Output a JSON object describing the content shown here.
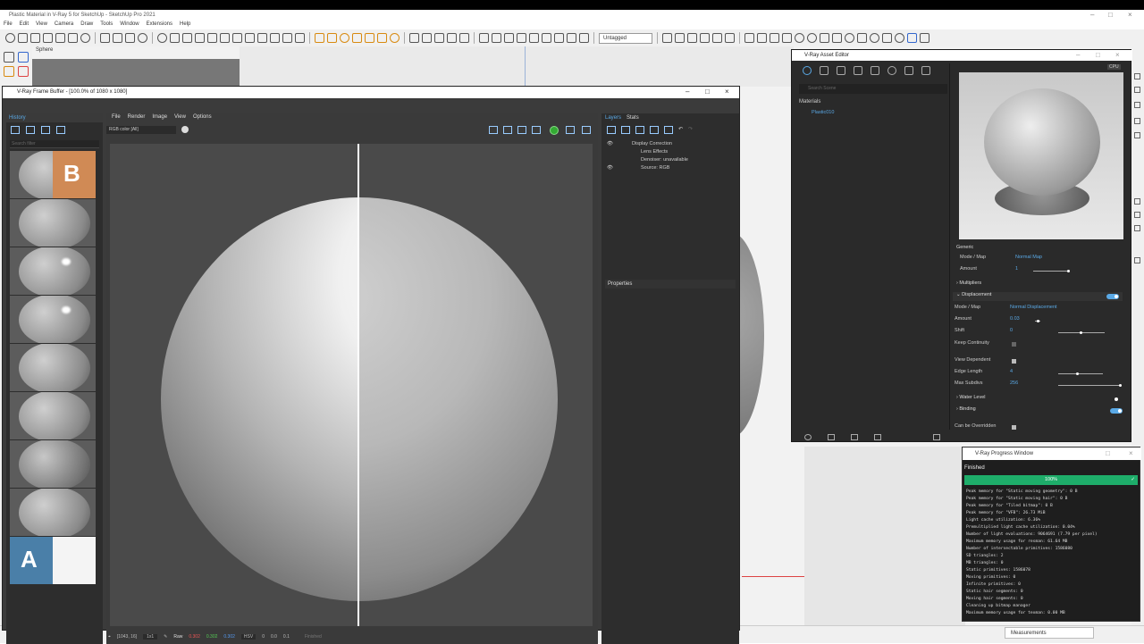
{
  "sketchup": {
    "title": "Plastic Material in V-Ray 5 for SketchUp - SketchUp Pro 2021",
    "menu": [
      "File",
      "Edit",
      "View",
      "Camera",
      "Draw",
      "Tools",
      "Window",
      "Extensions",
      "Help"
    ],
    "tag_select": "Untagged",
    "viewport_label": "Sphere",
    "measurements_label": "Measurements"
  },
  "vfb": {
    "title": "V-Ray Frame Buffer - [100.0% of 1080 x 1080]",
    "history_tab": "History",
    "search_placeholder": "Search filter",
    "badges": [
      "B",
      "A"
    ],
    "menu": [
      "File",
      "Render",
      "Image",
      "View",
      "Options"
    ],
    "channel_select": "RGB color [All]",
    "layer_tabs": [
      "Layers",
      "Stats"
    ],
    "layers": [
      {
        "label": "Display Correction",
        "visible": true
      },
      {
        "label": "Lens Effects",
        "visible": false
      },
      {
        "label": "Denoiser: unavailable",
        "visible": false
      },
      {
        "label": "Source: RGB",
        "visible": true
      }
    ],
    "properties_label": "Properties",
    "status": {
      "coords": "[1043, 16]",
      "zoom": "1x1",
      "mode": "Raw",
      "r": "0.302",
      "g": "0.302",
      "b": "0.302",
      "space": "HSV",
      "h": "0",
      "s": "0.0",
      "v": "0.1",
      "state": "Finished"
    }
  },
  "asset_editor": {
    "title": "V-Ray Asset Editor",
    "search_placeholder": "Search Scene",
    "materials_header": "Materials",
    "material_item": "Plastic010",
    "cpu_label": "CPU",
    "section_generic": "Generic",
    "params": {
      "mode_map_label": "Mode / Map",
      "normal_map": "Normal Map",
      "amount_label": "Amount",
      "amount_top": "1",
      "multipliers": "Multipliers",
      "displacement": "Displacement",
      "mode_map_label2": "Mode / Map",
      "normal_displacement": "Normal Displacement",
      "amount_label2": "Amount",
      "amount_disp": "0.03",
      "shift_label": "Shift",
      "shift": "0",
      "keep_continuity": "Keep Continuity",
      "view_dependent": "View Dependent",
      "edge_length_label": "Edge Length",
      "edge_length": "4",
      "max_subdivs_label": "Max Subdivs",
      "max_subdivs": "256",
      "water_level": "Water Level",
      "binding": "Binding",
      "can_be_overridden": "Can be Overridden"
    }
  },
  "progress": {
    "title": "V-Ray Progress Window",
    "status": "Finished",
    "percent": "100%",
    "log": [
      "Peak memory for \"Static moving geometry\": 0 B",
      "Peak memory for \"Static moving hair\": 0 B",
      "Peak memory for \"Tiled bitmap\": 0 B",
      "Peak memory for \"VFB\": 26.73 MiB",
      "Light cache utilization: 6.36%",
      "Premultiplied light cache utilization: 0.04%",
      "Number of light evaluations: 9064691 (7.79 per pixel)",
      "Maximum memory usage for resman: 61.64 MB",
      "Number of intersectable primitives: 1586080",
      "SD triangles: 2",
      "MB triangles: 0",
      "Static primitives: 1586078",
      "Moving primitives: 0",
      "Infinite primitives: 0",
      "Static hair segments: 0",
      "Moving hair segments: 0",
      "Cleaning up bitmap manager",
      "Maximum memory usage for texman: 0.00 MB"
    ]
  }
}
